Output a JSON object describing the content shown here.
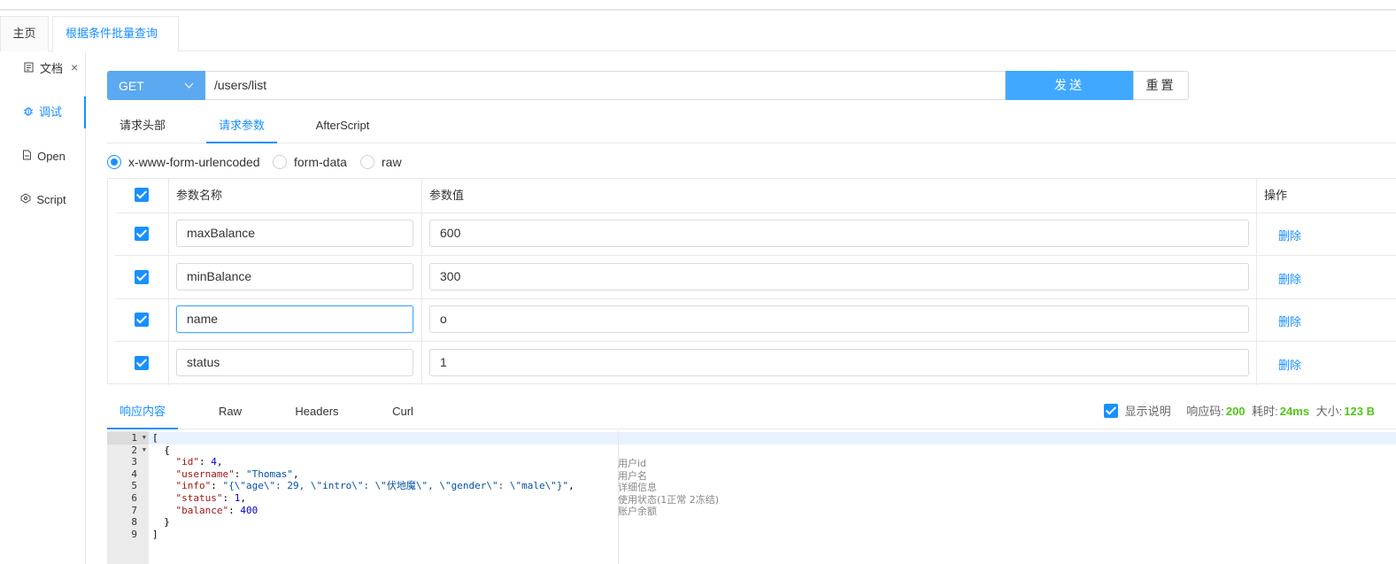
{
  "tabs": {
    "home": "主页",
    "active": "根据条件批量查询",
    "close": "×"
  },
  "sidebar": {
    "items": [
      {
        "label": "文档",
        "icon": "document-icon"
      },
      {
        "label": "调试",
        "icon": "bug-icon"
      },
      {
        "label": "Open",
        "icon": "file-icon"
      },
      {
        "label": "Script",
        "icon": "code-icon"
      }
    ]
  },
  "request": {
    "method": "GET",
    "url": "/users/list",
    "send_label": "发送",
    "reset_label": "重置"
  },
  "request_tabs": [
    "请求头部",
    "请求参数",
    "AfterScript"
  ],
  "body_types": [
    "x-www-form-urlencoded",
    "form-data",
    "raw"
  ],
  "params": {
    "headers": {
      "name": "参数名称",
      "value": "参数值",
      "action": "操作"
    },
    "rows": [
      {
        "name": "maxBalance",
        "value": "600",
        "delete": "删除"
      },
      {
        "name": "minBalance",
        "value": "300",
        "delete": "删除"
      },
      {
        "name": "name",
        "value": "o",
        "delete": "删除"
      },
      {
        "name": "status",
        "value": "1",
        "delete": "删除"
      }
    ]
  },
  "response_tabs": [
    "响应内容",
    "Raw",
    "Headers",
    "Curl"
  ],
  "response_meta": {
    "show_desc": "显示说明",
    "code_label": "响应码:",
    "code": "200",
    "time_label": "耗时:",
    "time": "24ms",
    "size_label": "大小:",
    "size": "123 B"
  },
  "code": {
    "line_numbers": [
      "1",
      "2",
      "3",
      "4",
      "5",
      "6",
      "7",
      "8",
      "9"
    ],
    "comments": [
      "用户id",
      "用户名",
      "详细信息",
      "使用状态(1正常 2冻结)",
      "账户余额"
    ]
  },
  "colors": {
    "accent": "#1890ff",
    "method_bg": "#5ba9f0",
    "send_bg": "#40a9ff",
    "success": "#52c41a"
  }
}
